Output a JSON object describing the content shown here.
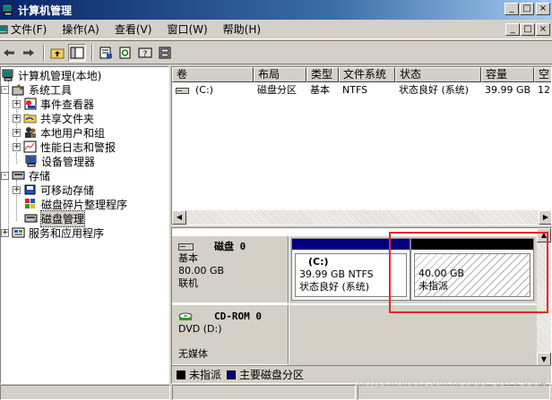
{
  "window": {
    "title": "计算机管理"
  },
  "menu": [
    "文件(F)",
    "操作(A)",
    "查看(V)",
    "窗口(W)",
    "帮助(H)"
  ],
  "window_buttons": [
    "_",
    "□",
    "×"
  ],
  "mdi_buttons": [
    "_",
    "□",
    "×"
  ],
  "toolbar": [
    "back-arrow",
    "forward-arrow",
    "up-folder",
    "show-hide-tree",
    "properties",
    "refresh",
    "help",
    "disk-properties"
  ],
  "tree": {
    "root": "计算机管理(本地)",
    "system_tools": "系统工具",
    "event_viewer": "事件查看器",
    "shared_folders": "共享文件夹",
    "local_users": "本地用户和组",
    "perf_logs": "性能日志和警报",
    "device_manager": "设备管理器",
    "storage": "存储",
    "removable": "可移动存储",
    "defrag": "磁盘碎片整理程序",
    "disk_mgmt": "磁盘管理",
    "services": "服务和应用程序",
    "expander_plus": "+",
    "expander_minus": "-"
  },
  "columns": [
    "卷",
    "布局",
    "类型",
    "文件系统",
    "状态",
    "容量",
    "空"
  ],
  "volume_rows": [
    {
      "volume": "(C:)",
      "layout": "磁盘分区",
      "type": "基本",
      "fs": "NTFS",
      "status": "状态良好 (系统)",
      "capacity": "39.99 GB",
      "free": "12"
    }
  ],
  "disk0": {
    "name": "磁盘 0",
    "type": "基本",
    "size": "80.00 GB",
    "status": "联机",
    "partition_c": {
      "label": "(C:)",
      "detail": "39.99 GB NTFS",
      "status": "状态良好 (系统)"
    },
    "unallocated": {
      "size": "40.00 GB",
      "label": "未指派"
    }
  },
  "cdrom0": {
    "name": "CD-ROM 0",
    "type": "DVD (D:)",
    "media": "无媒体"
  },
  "legend": {
    "unallocated": "未指派",
    "primary": "主要磁盘分区"
  },
  "colors": {
    "primary_partition": "#000080",
    "unallocated": "#000000",
    "highlight": "#e8262d"
  },
  "watermark": "https://blog.csdn.net/qq_36773804"
}
